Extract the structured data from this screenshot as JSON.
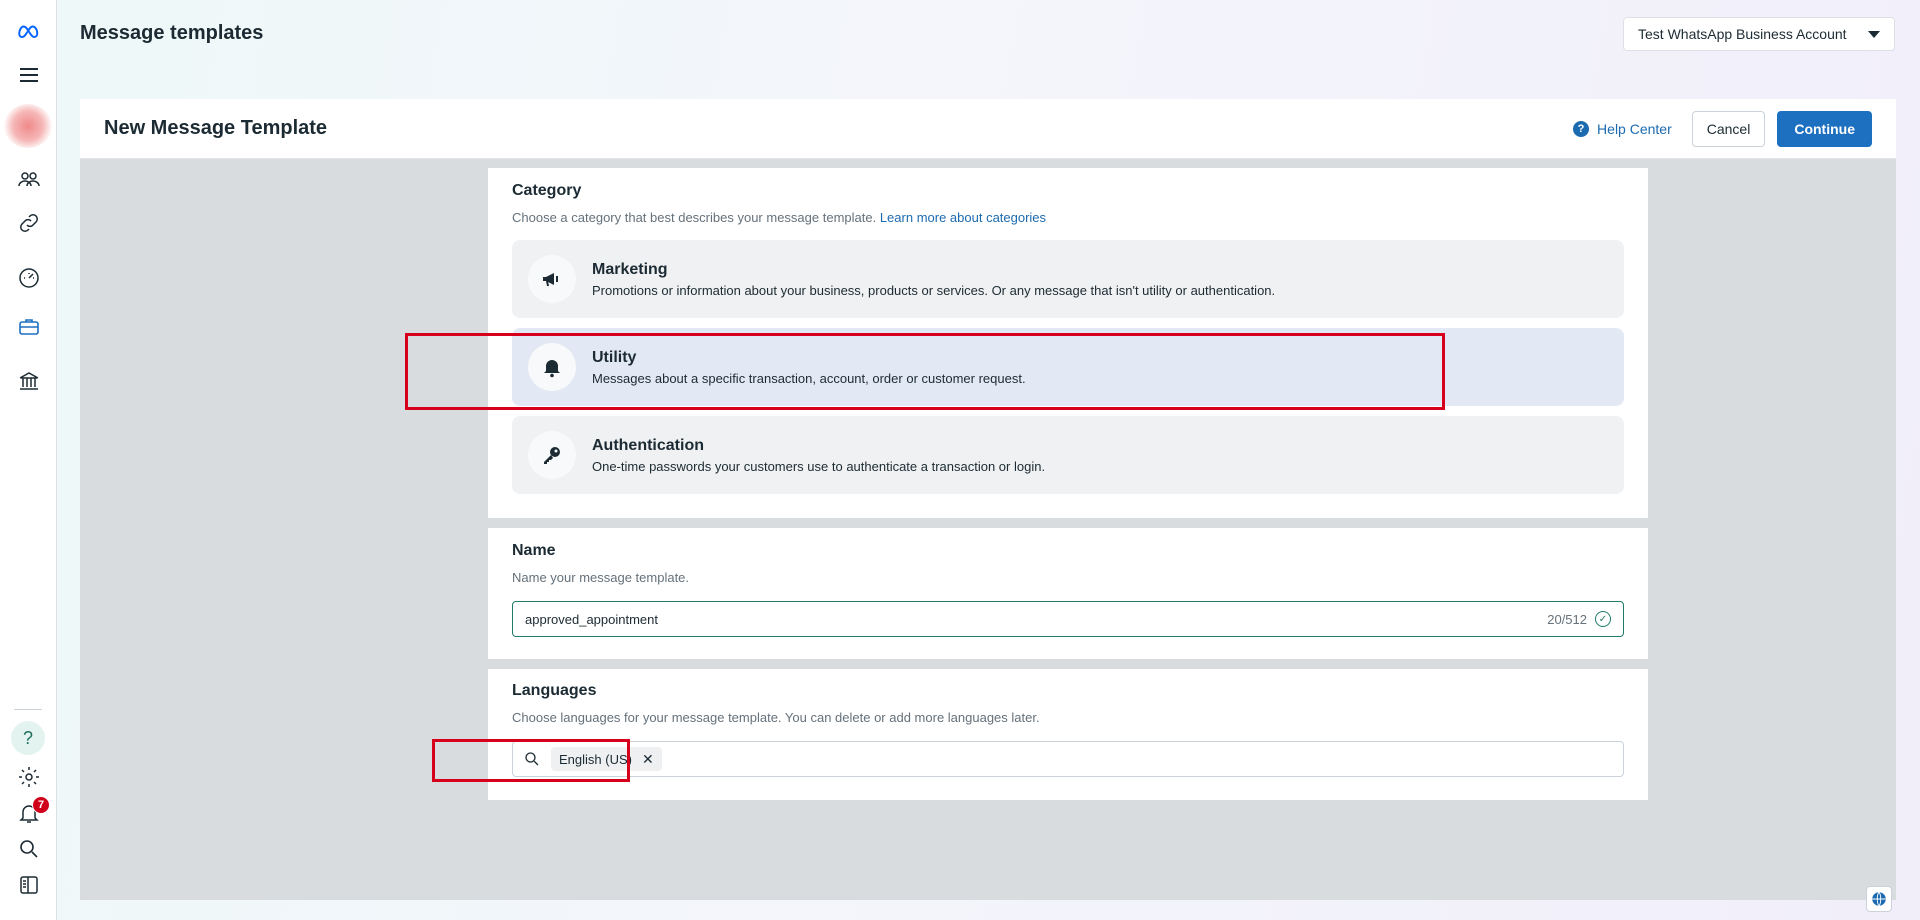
{
  "app": {
    "page_title": "Message templates",
    "account_selector": "Test WhatsApp Business Account"
  },
  "rail": {
    "notification_count": "7"
  },
  "header": {
    "title": "New Message Template",
    "help_center": "Help Center",
    "cancel": "Cancel",
    "continue": "Continue"
  },
  "category": {
    "title": "Category",
    "subtitle": "Choose a category that best describes your message template.",
    "learn_more": "Learn more about categories",
    "options": [
      {
        "name": "Marketing",
        "description": "Promotions or information about your business, products or services. Or any message that isn't utility or authentication.",
        "icon": "megaphone-icon"
      },
      {
        "name": "Utility",
        "description": "Messages about a specific transaction, account, order or customer request.",
        "icon": "bell-icon",
        "selected": true
      },
      {
        "name": "Authentication",
        "description": "One-time passwords your customers use to authenticate a transaction or login.",
        "icon": "key-icon"
      }
    ]
  },
  "name": {
    "title": "Name",
    "subtitle": "Name your message template.",
    "value": "approved_appointment",
    "counter": "20/512"
  },
  "languages": {
    "title": "Languages",
    "subtitle": "Choose languages for your message template. You can delete or add more languages later.",
    "selected": [
      "English (US)"
    ]
  },
  "colors": {
    "accent": "#1d6fbf",
    "highlight": "#d6001c",
    "valid": "#1f7a68"
  }
}
